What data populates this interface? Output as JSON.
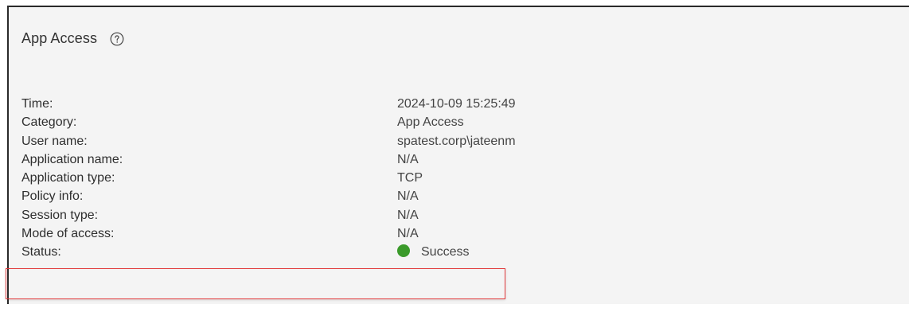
{
  "panel": {
    "title": "App Access",
    "help_icon": "question-circle-icon"
  },
  "details": [
    {
      "label": "Time:",
      "value": "2024-10-09 15:25:49"
    },
    {
      "label": "Category:",
      "value": "App Access"
    },
    {
      "label": "User name:",
      "value": "spatest.corp\\jateenm"
    },
    {
      "label": "Application name:",
      "value": "N/A"
    },
    {
      "label": "Application type:",
      "value": "TCP"
    },
    {
      "label": "Policy info:",
      "value": "N/A"
    },
    {
      "label": "Session type:",
      "value": "N/A"
    },
    {
      "label": "Mode of access:",
      "value": "N/A"
    },
    {
      "label": "Status:",
      "value": "Success"
    }
  ],
  "status": {
    "indicator_color": "#3a9a2a",
    "highlight_color": "#e2393a"
  }
}
